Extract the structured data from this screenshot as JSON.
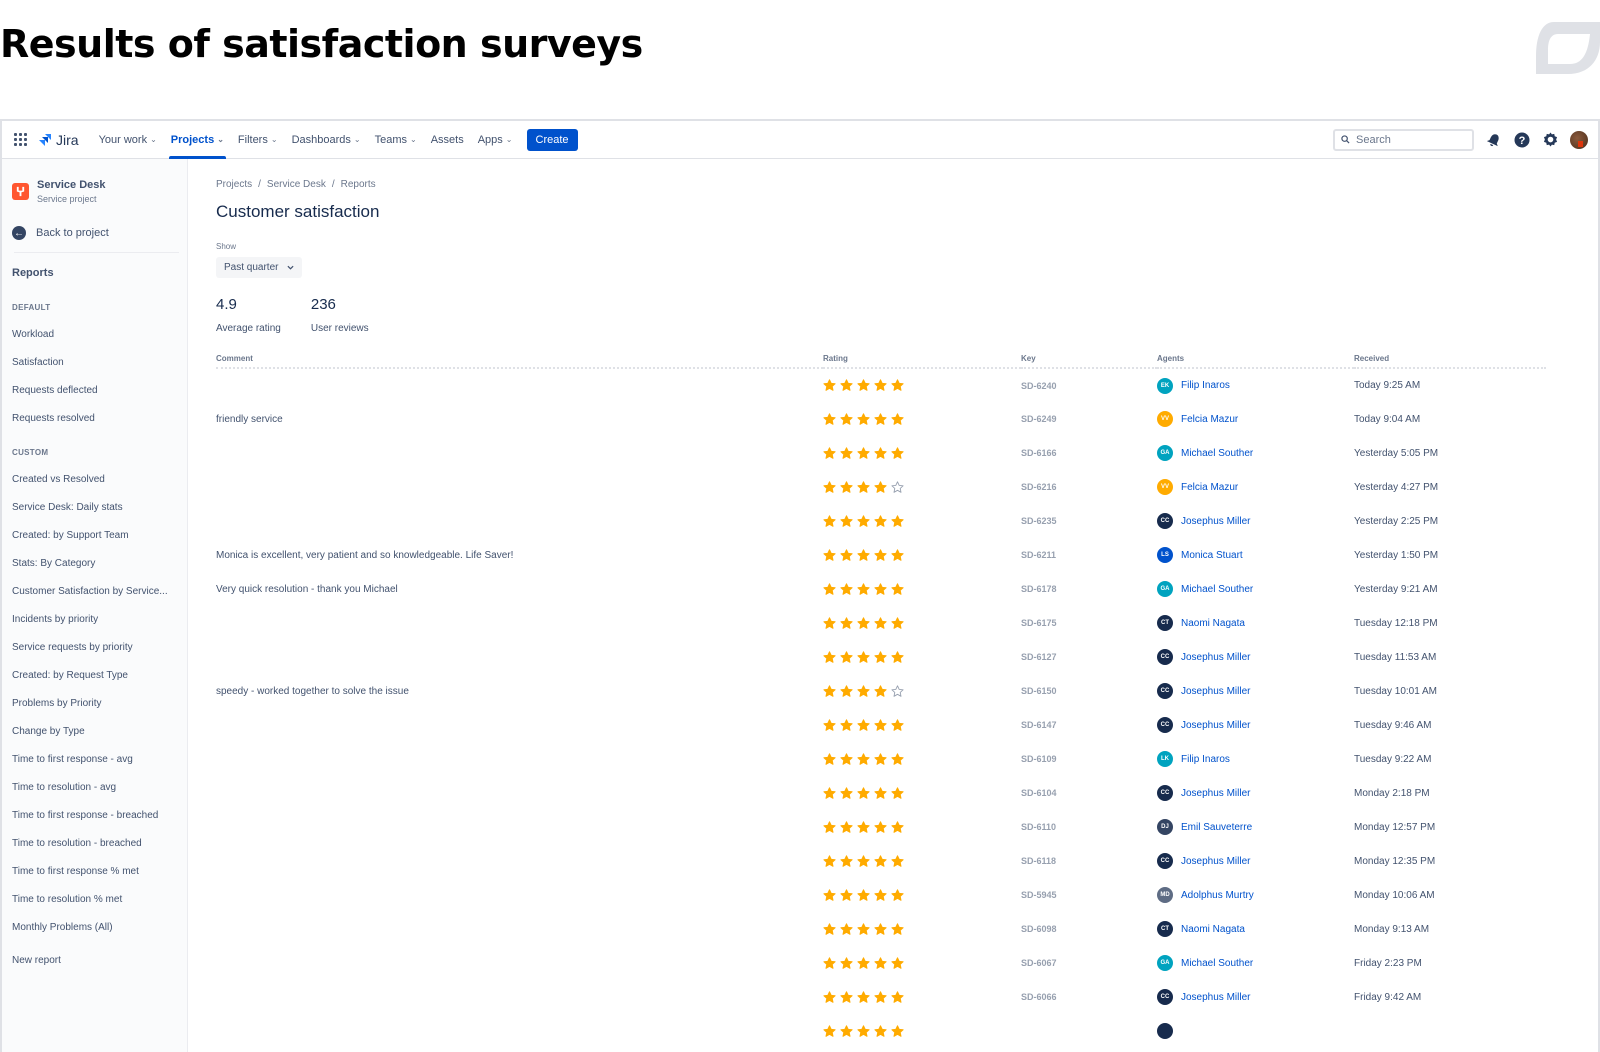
{
  "headline": "Results of satisfaction surveys",
  "topnav": {
    "product": "Jira",
    "items": [
      {
        "label": "Your work",
        "dropdown": true,
        "active": false
      },
      {
        "label": "Projects",
        "dropdown": true,
        "active": true
      },
      {
        "label": "Filters",
        "dropdown": true,
        "active": false
      },
      {
        "label": "Dashboards",
        "dropdown": true,
        "active": false
      },
      {
        "label": "Teams",
        "dropdown": true,
        "active": false
      },
      {
        "label": "Assets",
        "dropdown": false,
        "active": false
      },
      {
        "label": "Apps",
        "dropdown": true,
        "active": false
      }
    ],
    "create_label": "Create",
    "search_placeholder": "Search",
    "icons": [
      "notifications-icon",
      "help-icon",
      "settings-icon",
      "user-avatar"
    ]
  },
  "sidebar": {
    "project_name": "Service Desk",
    "project_type": "Service project",
    "back_label": "Back to project",
    "reports_title": "Reports",
    "default_label": "DEFAULT",
    "default_items": [
      "Workload",
      "Satisfaction",
      "Requests deflected",
      "Requests resolved"
    ],
    "custom_label": "CUSTOM",
    "custom_items": [
      "Created vs Resolved",
      "Service Desk: Daily stats",
      "Created: by Support Team",
      "Stats: By Category",
      "Customer Satisfaction by Service...",
      "Incidents by priority",
      "Service requests by priority",
      "Created: by Request Type",
      "Problems by Priority",
      "Change by Type",
      "Time to first response - avg",
      "Time to resolution - avg",
      "Time to first response - breached",
      "Time to resolution - breached",
      "Time to first response % met",
      "Time to resolution % met",
      "Monthly Problems (All)"
    ],
    "new_report_label": "New report"
  },
  "main": {
    "breadcrumb": [
      "Projects",
      "Service Desk",
      "Reports"
    ],
    "title": "Customer satisfaction",
    "show_label": "Show",
    "show_value": "Past quarter",
    "average_rating": "4.9",
    "average_rating_label": "Average rating",
    "user_reviews": "236",
    "user_reviews_label": "User reviews",
    "columns": [
      "Comment",
      "Rating",
      "Key",
      "Agents",
      "Received"
    ],
    "colors": {
      "star": "#ffab00",
      "star_empty": "#97a0af",
      "link": "#0052cc"
    },
    "rows": [
      {
        "comment": "",
        "rating": 5,
        "key": "SD-6240",
        "initials": "EK",
        "avatar_color": "#00a3bf",
        "agent": "Filip Inaros",
        "received": "Today 9:25 AM"
      },
      {
        "comment": "friendly service",
        "rating": 5,
        "key": "SD-6249",
        "initials": "VV",
        "avatar_color": "#ffab00",
        "agent": "Felcia Mazur",
        "received": "Today 9:04 AM"
      },
      {
        "comment": "",
        "rating": 5,
        "key": "SD-6166",
        "initials": "GA",
        "avatar_color": "#00a3bf",
        "agent": "Michael Souther",
        "received": "Yesterday 5:05 PM"
      },
      {
        "comment": "",
        "rating": 4,
        "key": "SD-6216",
        "initials": "VV",
        "avatar_color": "#ffab00",
        "agent": "Felcia Mazur",
        "received": "Yesterday 4:27 PM"
      },
      {
        "comment": "",
        "rating": 5,
        "key": "SD-6235",
        "initials": "CC",
        "avatar_color": "#172b4d",
        "agent": "Josephus Miller",
        "received": "Yesterday 2:25 PM"
      },
      {
        "comment": "Monica is excellent, very patient and so knowledgeable. Life Saver!",
        "rating": 5,
        "key": "SD-6211",
        "initials": "LS",
        "avatar_color": "#0052cc",
        "agent": "Monica Stuart",
        "received": "Yesterday 1:50 PM"
      },
      {
        "comment": "Very quick resolution - thank you Michael",
        "rating": 5,
        "key": "SD-6178",
        "initials": "GA",
        "avatar_color": "#00a3bf",
        "agent": "Michael Souther",
        "received": "Yesterday 9:21 AM"
      },
      {
        "comment": "",
        "rating": 5,
        "key": "SD-6175",
        "initials": "CT",
        "avatar_color": "#172b4d",
        "agent": "Naomi Nagata",
        "received": "Tuesday 12:18 PM"
      },
      {
        "comment": "",
        "rating": 5,
        "key": "SD-6127",
        "initials": "CC",
        "avatar_color": "#172b4d",
        "agent": "Josephus Miller",
        "received": "Tuesday 11:53 AM"
      },
      {
        "comment": "speedy - worked together to solve the issue",
        "rating": 4,
        "key": "SD-6150",
        "initials": "CC",
        "avatar_color": "#172b4d",
        "agent": "Josephus Miller",
        "received": "Tuesday 10:01 AM"
      },
      {
        "comment": "",
        "rating": 5,
        "key": "SD-6147",
        "initials": "CC",
        "avatar_color": "#172b4d",
        "agent": "Josephus Miller",
        "received": "Tuesday 9:46 AM"
      },
      {
        "comment": "",
        "rating": 5,
        "key": "SD-6109",
        "initials": "LK",
        "avatar_color": "#00a3bf",
        "agent": "Filip Inaros",
        "received": "Tuesday 9:22 AM"
      },
      {
        "comment": "",
        "rating": 5,
        "key": "SD-6104",
        "initials": "CC",
        "avatar_color": "#172b4d",
        "agent": "Josephus Miller",
        "received": "Monday 2:18 PM"
      },
      {
        "comment": "",
        "rating": 5,
        "key": "SD-6110",
        "initials": "DJ",
        "avatar_color": "#344563",
        "agent": "Emil Sauveterre",
        "received": "Monday 12:57 PM"
      },
      {
        "comment": "",
        "rating": 5,
        "key": "SD-6118",
        "initials": "CC",
        "avatar_color": "#172b4d",
        "agent": "Josephus Miller",
        "received": "Monday 12:35 PM"
      },
      {
        "comment": "",
        "rating": 5,
        "key": "SD-5945",
        "initials": "MD",
        "avatar_color": "#5e6c84",
        "agent": "Adolphus Murtry",
        "received": "Monday 10:06 AM"
      },
      {
        "comment": "",
        "rating": 5,
        "key": "SD-6098",
        "initials": "CT",
        "avatar_color": "#172b4d",
        "agent": "Naomi Nagata",
        "received": "Monday 9:13 AM"
      },
      {
        "comment": "",
        "rating": 5,
        "key": "SD-6067",
        "initials": "GA",
        "avatar_color": "#00a3bf",
        "agent": "Michael Souther",
        "received": "Friday 2:23 PM"
      },
      {
        "comment": "",
        "rating": 5,
        "key": "SD-6066",
        "initials": "CC",
        "avatar_color": "#172b4d",
        "agent": "Josephus Miller",
        "received": "Friday 9:42 AM"
      },
      {
        "comment": "",
        "rating": 5,
        "key": "",
        "initials": "",
        "avatar_color": "#172b4d",
        "agent": "",
        "received": ""
      }
    ]
  }
}
